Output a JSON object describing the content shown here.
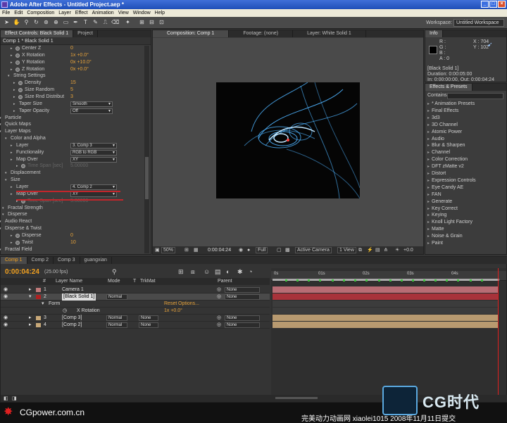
{
  "title_bar": {
    "title": "Adobe After Effects - Untitled Project.aep *"
  },
  "menu": [
    "File",
    "Edit",
    "Composition",
    "Layer",
    "Effect",
    "Animation",
    "View",
    "Window",
    "Help"
  ],
  "workspace": {
    "label": "Workspace:",
    "value": "Untitled Workspace"
  },
  "effect_controls": {
    "tabs": [
      "Effect Controls: Black Solid 1",
      "Project"
    ],
    "subtitle": "Comp 1 * Black Solid 1",
    "rows": [
      {
        "label": "Center Z",
        "value": "0",
        "kind": "value"
      },
      {
        "label": "X Rotation",
        "value": "1x +0.0°",
        "kind": "value"
      },
      {
        "label": "Y Rotation",
        "value": "0x +10.0°",
        "kind": "value"
      },
      {
        "label": "Z Rotation",
        "value": "0x +0.0°",
        "kind": "value"
      },
      {
        "label": "String Settings",
        "value": "",
        "kind": "group"
      },
      {
        "label": "Density",
        "value": "15",
        "kind": "value"
      },
      {
        "label": "Size Random",
        "value": "5",
        "kind": "value"
      },
      {
        "label": "Size Rnd Distribut",
        "value": "3",
        "kind": "value"
      },
      {
        "label": "Taper Size",
        "value": "Smooth",
        "kind": "drop"
      },
      {
        "label": "Taper Opacity",
        "value": "Off",
        "kind": "drop"
      },
      {
        "label": "Particle",
        "value": "",
        "kind": "group"
      },
      {
        "label": "Quick Maps",
        "value": "",
        "kind": "group"
      },
      {
        "label": "Layer Maps",
        "value": "",
        "kind": "group"
      },
      {
        "label": "Color and Alpha",
        "value": "",
        "kind": "group"
      },
      {
        "label": "Layer",
        "value": "3. Comp 3",
        "kind": "drop"
      },
      {
        "label": "Functionality",
        "value": "RGB to RGB",
        "kind": "drop"
      },
      {
        "label": "Map Over",
        "value": "XY",
        "kind": "drop"
      },
      {
        "label": "Time Span [sec]",
        "value": "5.00000",
        "kind": "dim"
      },
      {
        "label": "Displacement",
        "value": "",
        "kind": "group"
      },
      {
        "label": "Size",
        "value": "",
        "kind": "group"
      },
      {
        "label": "Layer",
        "value": "4. Comp 2",
        "kind": "drop"
      },
      {
        "label": "Map Over",
        "value": "XY",
        "kind": "drop"
      },
      {
        "label": "Time Span [sec]",
        "value": "5.00000",
        "kind": "dim"
      },
      {
        "label": "Fractal Strength",
        "value": "",
        "kind": "group"
      },
      {
        "label": "Disperse",
        "value": "",
        "kind": "group"
      },
      {
        "label": "Audio React",
        "value": "",
        "kind": "group"
      },
      {
        "label": "Disperse & Twist",
        "value": "",
        "kind": "group"
      },
      {
        "label": "Disperse",
        "value": "0",
        "kind": "value"
      },
      {
        "label": "Twist",
        "value": "10",
        "kind": "value"
      },
      {
        "label": "Fractal Field",
        "value": "",
        "kind": "group"
      }
    ]
  },
  "composition": {
    "tabs": [
      "Composition: Comp 1",
      "Footage: (none)",
      "Layer: White Solid 1"
    ],
    "zoom": "50%",
    "timecode": "0:00:04:24",
    "resolution": "Full",
    "camera": "Active Camera",
    "view": "1 View",
    "exposure": "+0.0"
  },
  "info": {
    "title": "Info",
    "channels": [
      "R :",
      "G :",
      "B :",
      "A : 0"
    ],
    "coords": [
      "X : 704",
      "Y : 102"
    ],
    "layer": "[Black Solid 1]",
    "duration": "Duration: 0:00:05:00",
    "in_out": "In: 0:00:00:00, Out: 0:00:04:24"
  },
  "effects_presets": {
    "title": "Effects & Presets",
    "contains_label": "Contains:",
    "items": [
      "* Animation Presets",
      "Final Effects",
      "3d3",
      "3D Channel",
      "Atomic Power",
      "Audio",
      "Blur & Sharpen",
      "Channel",
      "Color Correction",
      "DFT zMatte v2",
      "Distort",
      "Expression Controls",
      "Eye Candy AE",
      "FAN",
      "Generate",
      "Key Correct",
      "Keying",
      "Knoll Light Factory",
      "Matte",
      "Noise & Grain",
      "Paint"
    ]
  },
  "timeline": {
    "tabs": [
      "Comp 1",
      "Comp 2",
      "Comp 3",
      "guangxian"
    ],
    "timecode": "0:00:04:24",
    "fps": "(25.00 fps)",
    "headers": {
      "num": "#",
      "name": "Layer Name",
      "mode": "Mode",
      "t": "T",
      "trkmat": "TrkMat",
      "parent": "Parent"
    },
    "layers": [
      {
        "num": "1",
        "name": "Camera 1",
        "mode": "",
        "trkmat": "",
        "parent": "None",
        "color": "#c07a7a"
      },
      {
        "num": "2",
        "name": "[Black Solid 1]",
        "mode": "Normal",
        "trkmat": "",
        "parent": "None",
        "color": "#b02020"
      },
      {
        "num": "3",
        "name": "[Comp 3]",
        "mode": "Normal",
        "trkmat": "None",
        "parent": "None",
        "color": "#c8a878"
      },
      {
        "num": "4",
        "name": "[Comp 2]",
        "mode": "Normal",
        "trkmat": "None",
        "parent": "None",
        "color": "#c8a878"
      }
    ],
    "sublayer": {
      "group": "Form",
      "reset": "Reset",
      "options": "Options...",
      "prop": "X Rotation",
      "value": "1x +0.0°"
    },
    "ruler": [
      "0s",
      "01s",
      "02s",
      "03s",
      "04s"
    ]
  },
  "footer": {
    "brand": "CGpower.com.cn",
    "caption": "完美动力动画网 xiaolei1015 2008年11月11日提交",
    "logo_text": "CG时代"
  }
}
